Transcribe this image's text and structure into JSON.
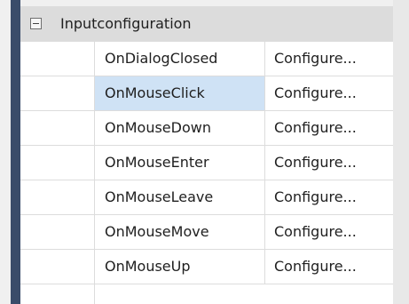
{
  "category": {
    "label": "Inputconfiguration"
  },
  "rows": [
    {
      "name": "OnDialogClosed",
      "value": "Configure..."
    },
    {
      "name": "OnMouseClick",
      "value": "Configure..."
    },
    {
      "name": "OnMouseDown",
      "value": "Configure..."
    },
    {
      "name": "OnMouseEnter",
      "value": "Configure..."
    },
    {
      "name": "OnMouseLeave",
      "value": "Configure..."
    },
    {
      "name": "OnMouseMove",
      "value": "Configure..."
    },
    {
      "name": "OnMouseUp",
      "value": "Configure..."
    }
  ],
  "selected_row": "OnMouseClick",
  "colors": {
    "category_bg": "#dcdcdc",
    "selection_bg": "#cfe2f5",
    "left_border": "#3a4c6a",
    "grid_line": "#dcdcdc"
  }
}
